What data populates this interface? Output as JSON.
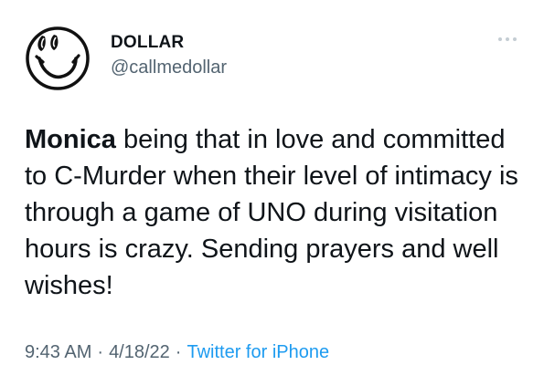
{
  "tweet": {
    "author": {
      "display_name": "DOLLAR",
      "handle": "@callmedollar",
      "avatar_icon": "smiley-face-icon"
    },
    "menu_icon": "more-dots-icon",
    "text": {
      "mention": "Monica",
      "body": " being that in love and committed to C-Murder when their level of intimacy is through a game of UNO during visitation hours is crazy. Sending prayers and well wishes!"
    },
    "meta": {
      "time": "9:43 AM",
      "separator": "·",
      "date": "4/18/22",
      "source": "Twitter for iPhone"
    }
  },
  "colors": {
    "text_primary": "#0f1419",
    "text_secondary": "#536471",
    "link": "#1d9bf0",
    "dots": "#c4cdd3"
  }
}
